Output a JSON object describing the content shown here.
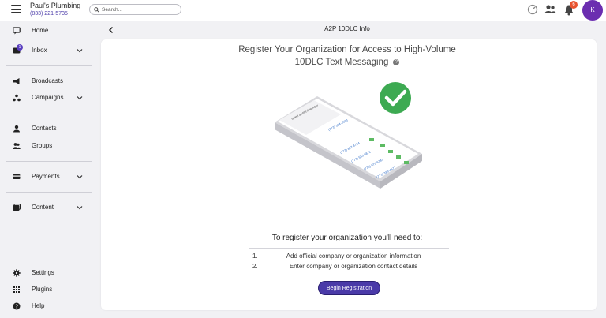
{
  "brand": {
    "name": "Paul's Plumbing",
    "phone": "(833) 221-5735"
  },
  "search": {
    "placeholder": "Search..."
  },
  "notifications": {
    "count": "6"
  },
  "user": {
    "initial": "K"
  },
  "sidebar": {
    "items": [
      {
        "label": "Home",
        "icon": "home-icon"
      },
      {
        "label": "Inbox",
        "icon": "inbox-icon",
        "badge": "1"
      },
      {
        "label": "Broadcasts",
        "icon": "megaphone-icon"
      },
      {
        "label": "Campaigns",
        "icon": "campaigns-icon"
      },
      {
        "label": "Contacts",
        "icon": "person-icon"
      },
      {
        "label": "Groups",
        "icon": "group-icon"
      },
      {
        "label": "Payments",
        "icon": "payments-icon"
      },
      {
        "label": "Content",
        "icon": "content-icon"
      },
      {
        "label": "Settings",
        "icon": "gear-icon"
      },
      {
        "label": "Plugins",
        "icon": "grid-icon"
      },
      {
        "label": "Help",
        "icon": "help-icon"
      }
    ]
  },
  "page": {
    "title": "A2P 10DLC Info",
    "heading_line1": "Register Your Organization for Access to High-Volume",
    "heading_line2": "10DLC Text Messaging",
    "help_glyph": "?",
    "illustration": {
      "card_title": "Select a 10DLC Number",
      "numbers": [
        "(773) 364-4593",
        "(773) 832-4704",
        "(773) 583-9876",
        "(773) 975-5743",
        "(773) 389-4577"
      ]
    },
    "need_title": "To register your organization you'll need to:",
    "steps": [
      {
        "num": "1.",
        "text": "Add official company or organization information"
      },
      {
        "num": "2.",
        "text": "Enter company or organization contact details"
      }
    ],
    "begin_button": "Begin Registration"
  },
  "colors": {
    "accent": "#4a3aa8",
    "avatar": "#6b2eb0",
    "badge": "#e8532f",
    "check": "#3daa52"
  }
}
